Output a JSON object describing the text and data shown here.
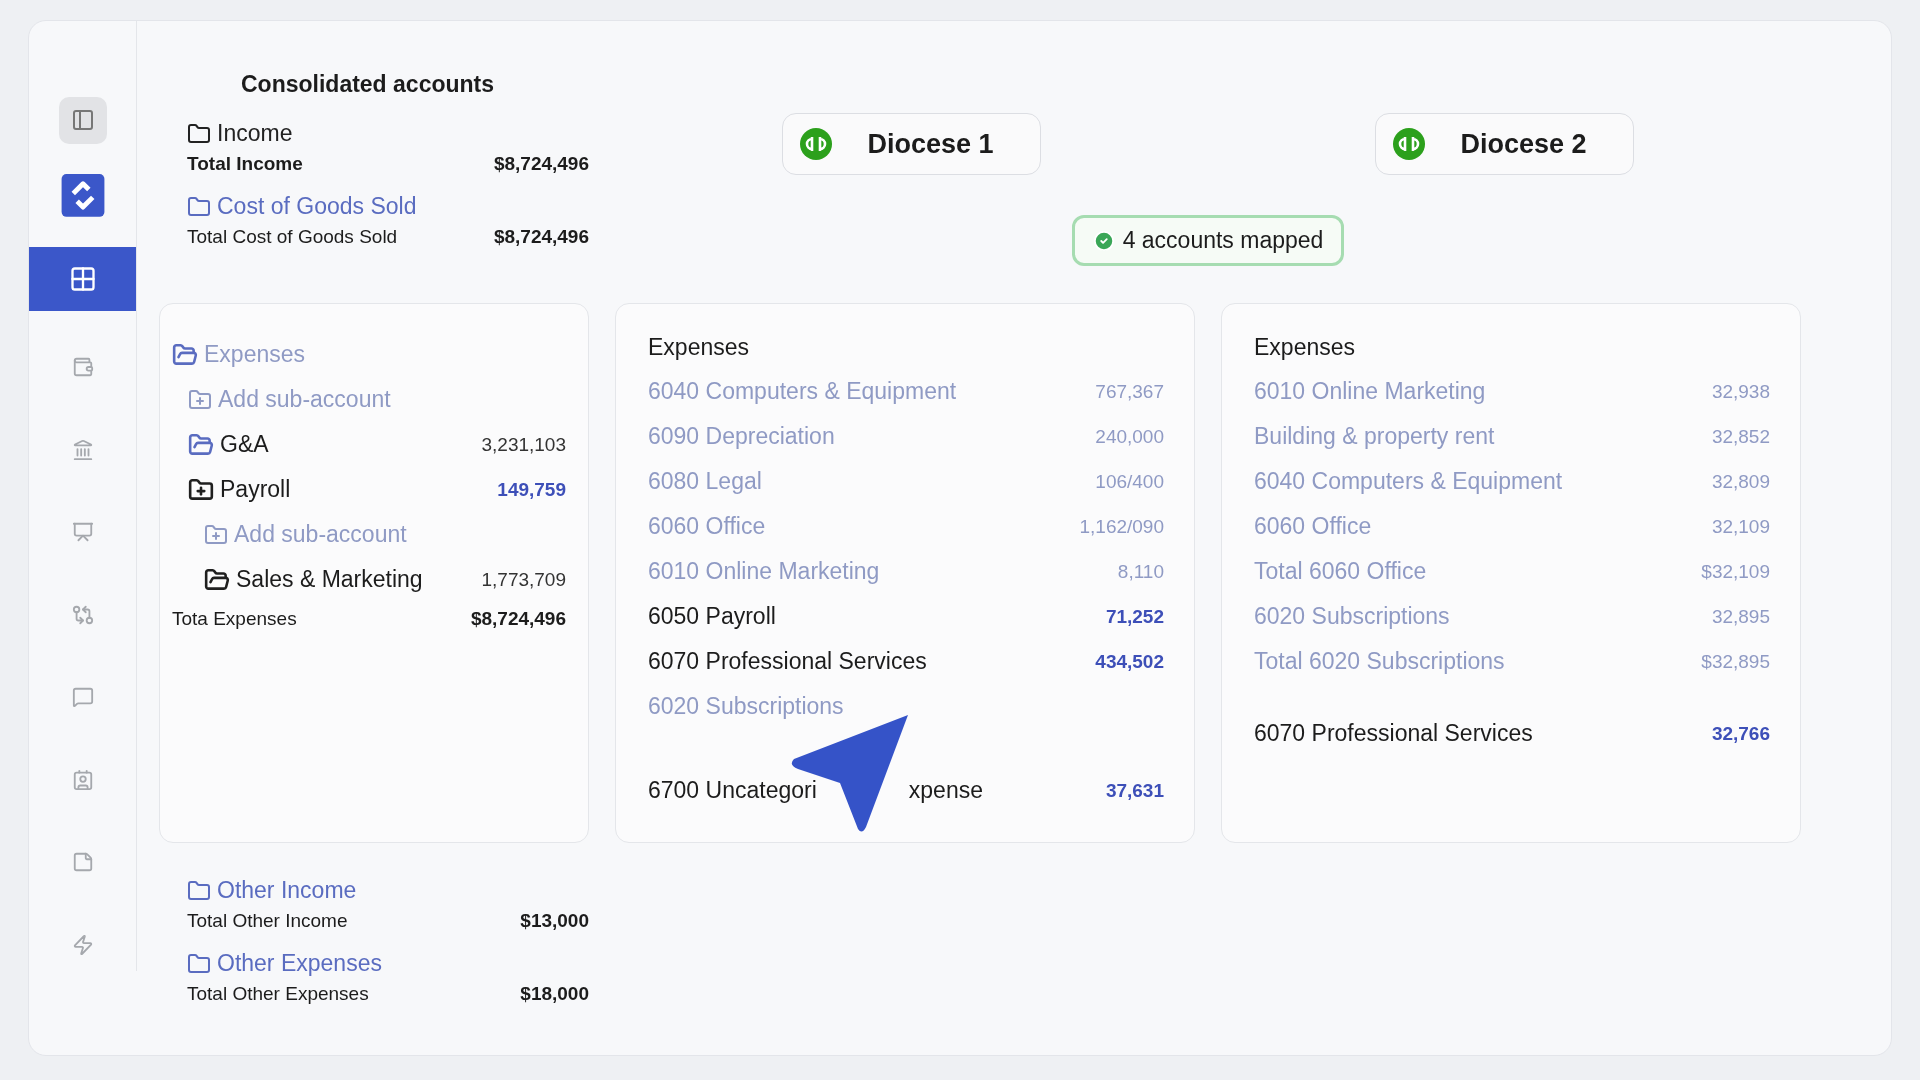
{
  "sidebar": {
    "items": [
      {
        "selected": true
      },
      {
        "selected": false
      },
      {
        "selected": false
      },
      {
        "selected": false
      },
      {
        "selected": false
      },
      {
        "selected": false
      },
      {
        "selected": false
      },
      {
        "selected": false
      },
      {
        "selected": false
      }
    ]
  },
  "consolidated": {
    "title": "Consolidated accounts",
    "groups_top": [
      {
        "name": "Income",
        "highlighted": false,
        "total_label": "Total Income",
        "bold_total": true,
        "total_value": "$8,724,496"
      },
      {
        "name": "Cost of Goods Sold",
        "highlighted": true,
        "total_label": "Total Cost of Goods Sold",
        "bold_total": false,
        "total_value": "$8,724,496"
      }
    ],
    "expenses": {
      "header": "Expenses",
      "items": [
        {
          "kind": "add",
          "label": "Add sub-account"
        },
        {
          "kind": "account",
          "name": "G&A",
          "value": "3,231,103",
          "color": "#5a6cc0",
          "highlighted": false
        },
        {
          "kind": "account",
          "name": "Payroll",
          "value": "149,759",
          "color": "#1f1f1f",
          "highlighted": true,
          "children": [
            {
              "kind": "add",
              "label": "Add sub-account"
            },
            {
              "kind": "account",
              "name": "Sales & Marketing",
              "value": "1,773,709",
              "color": "#1f1f1f",
              "highlighted": false
            }
          ]
        }
      ],
      "total_label": "Tota Expenses",
      "total_value": "$8,724,496"
    },
    "groups_bottom": [
      {
        "name": "Other Income",
        "highlighted": true,
        "total_label": "Total Other Income",
        "bold_total": false,
        "total_value": "$13,000"
      },
      {
        "name": "Other Expenses",
        "highlighted": true,
        "total_label": "Total Other Expenses",
        "bold_total": false,
        "total_value": "$18,000"
      }
    ]
  },
  "sources": [
    {
      "name": "Diocese 1"
    },
    {
      "name": "Diocese 2"
    }
  ],
  "mapped_badge": "4 accounts mapped",
  "panels": [
    {
      "header": "Expenses",
      "rows": [
        {
          "code": "6040",
          "name": "Computers & Equipment",
          "value": "767,367",
          "dimmed": true
        },
        {
          "code": "6090",
          "name": "Depreciation",
          "value": "240,000",
          "dimmed": true
        },
        {
          "code": "6080",
          "name": "Legal",
          "value": "106/400",
          "dimmed": true
        },
        {
          "code": "6060",
          "name": "Office",
          "value": "1,162/090",
          "dimmed": true
        },
        {
          "code": "6010",
          "name": "Online Marketing",
          "value": "8,110",
          "dimmed": true
        },
        {
          "code": "6050",
          "name": "Payroll",
          "value": "71,252",
          "dimmed": false
        },
        {
          "code": "6070",
          "name": "Professional Services",
          "value": "434,502",
          "dimmed": false
        },
        {
          "code": "6020",
          "name": "Subscriptions",
          "dimmed": true
        }
      ],
      "footer": {
        "code": "6700",
        "name": "Uncategori",
        "name_tail": "xpense",
        "value": "37,631"
      }
    },
    {
      "header": "Expenses",
      "rows": [
        {
          "name": "6010 Online Marketing",
          "value": "32,938",
          "dimmed": true
        },
        {
          "name": "Building & property rent",
          "value": "32,852",
          "dimmed": true
        },
        {
          "name": "6040 Computers & Equipment",
          "value": "32,809",
          "dimmed": true
        },
        {
          "name": "6060 Office",
          "value": "32,109",
          "dimmed": true
        },
        {
          "name": "Total 6060 Office",
          "value": "$32,109",
          "dimmed": true
        },
        {
          "name": "6020 Subscriptions",
          "value": "32,895",
          "dimmed": true
        },
        {
          "name": "Total 6020 Subscriptions",
          "value": "$32,895",
          "dimmed": true
        }
      ],
      "footer": {
        "name": "6070 Professional Services",
        "value": "32,766"
      }
    }
  ]
}
